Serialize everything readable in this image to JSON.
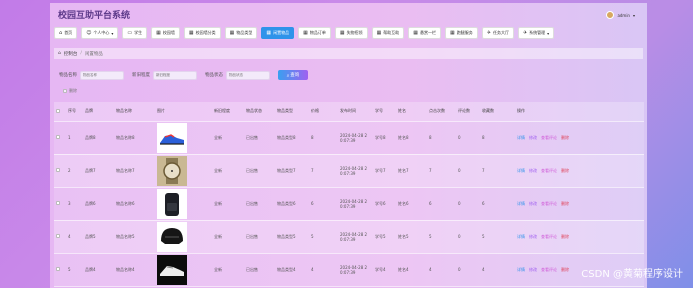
{
  "header": {
    "title": "校园互助平台系统",
    "user": "admin"
  },
  "nav": [
    {
      "label": "首页",
      "icon": "⌂"
    },
    {
      "label": "个人中心",
      "icon": "☺",
      "caret": true
    },
    {
      "label": "学生",
      "icon": "▭"
    },
    {
      "label": "校园墙",
      "icon": "▦"
    },
    {
      "label": "校园墙分类",
      "icon": "▦"
    },
    {
      "label": "物品类型",
      "icon": "▦"
    },
    {
      "label": "闲置物品",
      "icon": "▦",
      "active": true
    },
    {
      "label": "物品订单",
      "icon": "▦"
    },
    {
      "label": "失物招领",
      "icon": "▦"
    },
    {
      "label": "帮助互助",
      "icon": "▦"
    },
    {
      "label": "悬赏一栏",
      "icon": "▦"
    },
    {
      "label": "跑腿服务",
      "icon": "▦"
    },
    {
      "label": "任务大厅",
      "icon": "✈"
    },
    {
      "label": "系统管理",
      "icon": "✈",
      "caret": true
    }
  ],
  "breadcrumb": {
    "home": "控制台",
    "current": "闲置物品"
  },
  "search": {
    "fields": [
      {
        "label": "物品名称",
        "placeholder": "物品名称"
      },
      {
        "label": "新旧程度",
        "placeholder": "新旧程度"
      },
      {
        "label": "物品状态",
        "placeholder": "物品状态"
      }
    ],
    "button": "查询"
  },
  "bulk_delete": "删除",
  "table": {
    "headers": [
      "",
      "序号",
      "品牌",
      "物品名称",
      "图片",
      "新旧程度",
      "物品状态",
      "物品类型",
      "价格",
      "发布时间",
      "学号",
      "姓名",
      "点击次数",
      "评论数",
      "收藏数",
      "操作"
    ],
    "rows": [
      {
        "index": "1",
        "brand": "品牌8",
        "name": "物品名称8",
        "img": "sneaker",
        "condition": "全新",
        "status": "已出售",
        "type": "物品类型8",
        "price": "8",
        "time": [
          "2024-04-28 2",
          "0:07:39"
        ],
        "sid": "学号8",
        "student": "姓名8",
        "clicks": "8",
        "comments": "0",
        "favs": "8"
      },
      {
        "index": "2",
        "brand": "品牌7",
        "name": "物品名称7",
        "img": "watch",
        "condition": "全新",
        "status": "已出售",
        "type": "物品类型7",
        "price": "7",
        "time": [
          "2024-04-28 2",
          "0:07:39"
        ],
        "sid": "学号7",
        "student": "姓名7",
        "clicks": "7",
        "comments": "0",
        "favs": "7"
      },
      {
        "index": "3",
        "brand": "品牌6",
        "name": "物品名称6",
        "img": "backpack",
        "condition": "全新",
        "status": "已出售",
        "type": "物品类型6",
        "price": "6",
        "time": [
          "2024-04-28 2",
          "0:07:39"
        ],
        "sid": "学号6",
        "student": "姓名6",
        "clicks": "6",
        "comments": "0",
        "favs": "6"
      },
      {
        "index": "4",
        "brand": "品牌5",
        "name": "物品名称5",
        "img": "helmet",
        "condition": "全新",
        "status": "已出售",
        "type": "物品类型5",
        "price": "5",
        "time": [
          "2024-04-28 2",
          "0:07:39"
        ],
        "sid": "学号5",
        "student": "姓名5",
        "clicks": "5",
        "comments": "0",
        "favs": "5"
      },
      {
        "index": "5",
        "brand": "品牌4",
        "name": "物品名称4",
        "img": "shoe",
        "condition": "全新",
        "status": "已出售",
        "type": "物品类型4",
        "price": "4",
        "time": [
          "2024-04-28 2",
          "0:07:39"
        ],
        "sid": "学号4",
        "student": "姓名4",
        "clicks": "4",
        "comments": "0",
        "favs": "4"
      }
    ],
    "actions": [
      "详情",
      "修改",
      "查看评论",
      "删除"
    ]
  },
  "watermark": "CSDN @黄菊程序设计"
}
